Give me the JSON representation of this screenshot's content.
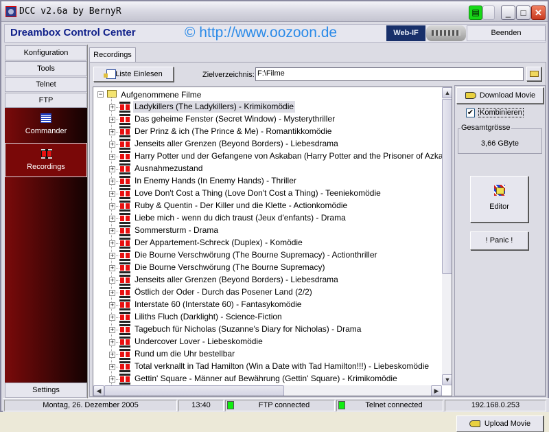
{
  "window": {
    "title": "DCC v2.6a by BernyR",
    "controls": {
      "minimize": "_",
      "maximize": "□",
      "close": "✕"
    }
  },
  "header": {
    "app_name": "Dreambox Control Center",
    "url": "© http://www.oozoon.de",
    "webif_label": "Web-IF",
    "quit_label": "Beenden"
  },
  "nav": {
    "buttons": [
      "Konfiguration",
      "Tools",
      "Telnet",
      "FTP"
    ],
    "items": [
      {
        "label": "Commander",
        "icon": "calendar-grid-icon",
        "active": false
      },
      {
        "label": "Recordings",
        "icon": "film-icon",
        "active": true
      }
    ],
    "settings_label": "Settings"
  },
  "main": {
    "tab_label": "Recordings",
    "load_list_label": "Liste Einlesen",
    "target_dir_label": "Zielverzeichnis:",
    "target_dir_value": "F:\\Filme",
    "tree": {
      "root_label": "Aufgenommene Filme",
      "selected_index": 0,
      "items": [
        "Ladykillers (The Ladykillers) - Krimikomödie",
        "Das geheime Fenster (Secret Window) - Mysterythriller",
        "Der Prinz & ich (The Prince & Me) - Romantikkomödie",
        "Jenseits aller Grenzen (Beyond Borders) - Liebesdrama",
        "Harry Potter und der Gefangene von Askaban (Harry Potter and the Prisoner of Azkaban)",
        "Ausnahmezustand",
        "In Enemy Hands (In Enemy Hands) - Thriller",
        "Love Don't Cost a Thing (Love Don't Cost a Thing) - Teeniekomödie",
        "Ruby & Quentin - Der Killer und die Klette - Actionkomödie",
        "Liebe mich - wenn du dich traust (Jeux d'enfants) - Drama",
        "Sommersturm - Drama",
        "Der Appartement-Schreck (Duplex) - Komödie",
        "Die Bourne Verschwörung (The Bourne Supremacy) - Actionthriller",
        "Die Bourne Verschwörung (The Bourne Supremacy)",
        "Jenseits aller Grenzen (Beyond Borders) - Liebesdrama",
        "Östlich der Oder - Durch das Posener Land (2/2)",
        "Interstate 60 (Interstate 60) - Fantasykomödie",
        "Liliths Fluch (Darklight) - Science-Fiction",
        "Tagebuch für Nicholas (Suzanne's Diary for Nicholas) - Drama",
        "Undercover Lover - Liebeskomödie",
        "Rund um die Uhr bestellbar",
        "Total verknallt in Tad Hamilton (Win a Date with Tad Hamilton!!!) - Liebeskomödie",
        "Gettin' Square - Männer auf Bewährung (Gettin' Square) - Krimikomödie"
      ]
    }
  },
  "side": {
    "download_label": "Download Movie",
    "combine_label": "Kombinieren",
    "combine_checked": true,
    "total_size_label": "Gesamtgrösse",
    "total_size_value": "3,66 GByte",
    "editor_label": "Editor",
    "panic_label": "! Panic !",
    "upload_label": "Upload Movie"
  },
  "status": {
    "date": "Montag, 26. Dezember 2005",
    "time": "13:40",
    "ftp": "FTP connected",
    "telnet": "Telnet connected",
    "ip": "192.168.0.253",
    "led_color": "#10ee10"
  }
}
